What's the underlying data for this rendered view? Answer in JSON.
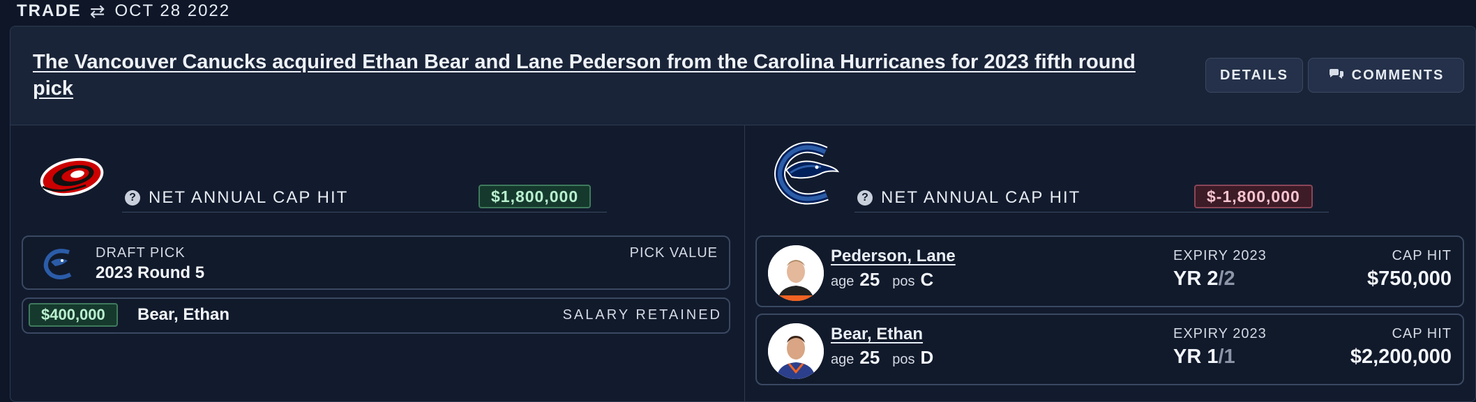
{
  "topbar": {
    "type_label": "TRADE",
    "date": "OCT 28 2022"
  },
  "header": {
    "headline": "The Vancouver Canucks acquired Ethan Bear and Lane Pederson from the Carolina Hurricanes for 2023 fifth round pick",
    "details_label": "DETAILS",
    "comments_label": "COMMENTS"
  },
  "left": {
    "team_logo": "hurricanes-logo",
    "cap_label": "NET ANNUAL CAP HIT",
    "cap_value": "$1,800,000",
    "draft_pick": {
      "type_label": "DRAFT PICK",
      "pick": "2023 Round 5",
      "value_label": "PICK VALUE"
    },
    "retained": {
      "amount": "$400,000",
      "player": "Bear, Ethan",
      "label": "SALARY RETAINED"
    }
  },
  "right": {
    "team_logo": "canucks-logo",
    "cap_label": "NET ANNUAL CAP HIT",
    "cap_value": "$-1,800,000",
    "players": [
      {
        "name": "Pederson, Lane",
        "age_label": "age",
        "age": "25",
        "pos_label": "pos",
        "pos": "C",
        "expiry": "EXPIRY 2023",
        "yr_label": "YR",
        "yr_current": "2",
        "yr_total": "/2",
        "caphit_label": "CAP HIT",
        "caphit": "$750,000"
      },
      {
        "name": "Bear, Ethan",
        "age_label": "age",
        "age": "25",
        "pos_label": "pos",
        "pos": "D",
        "expiry": "EXPIRY 2023",
        "yr_label": "YR",
        "yr_current": "1",
        "yr_total": "/1",
        "caphit_label": "CAP HIT",
        "caphit": "$2,200,000"
      }
    ]
  },
  "colors": {
    "background": "#0e1628",
    "positive": "#b9f0cf",
    "negative": "#f7c4cf",
    "hurricanes_red": "#cc0000",
    "canucks_blue": "#00205b"
  }
}
